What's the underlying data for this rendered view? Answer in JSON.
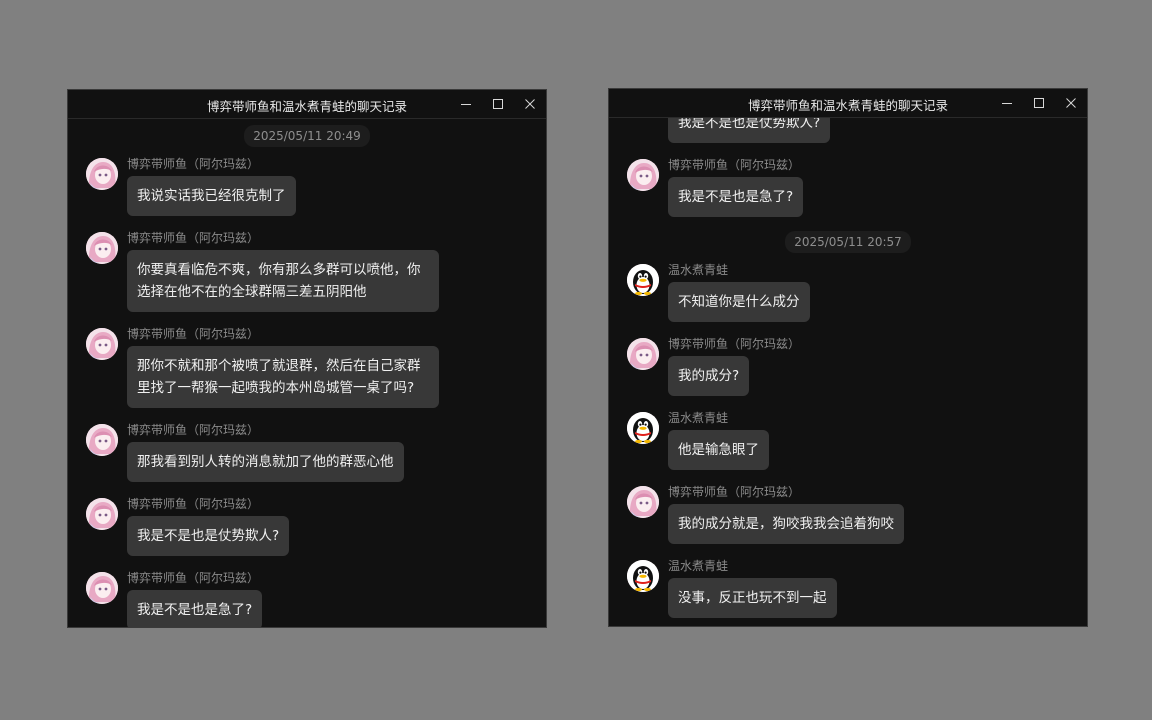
{
  "window_left": {
    "title": "博弈带师鱼和温水煮青蛙的聊天记录",
    "items": [
      {
        "kind": "timestamp",
        "text": "2025/05/11 20:49"
      },
      {
        "kind": "message",
        "sender": "博弈带师鱼（阿尔玛兹）",
        "avatar": "anime-girl-avatar",
        "text": "我说实话我已经很克制了"
      },
      {
        "kind": "message",
        "sender": "博弈带师鱼（阿尔玛兹）",
        "avatar": "anime-girl-avatar",
        "text": "你要真看临危不爽，你有那么多群可以喷他，你选择在他不在的全球群隔三差五阴阳他"
      },
      {
        "kind": "message",
        "sender": "博弈带师鱼（阿尔玛兹）",
        "avatar": "anime-girl-avatar",
        "text": "那你不就和那个被喷了就退群，然后在自己家群里找了一帮猴一起喷我的本州岛城管一桌了吗?"
      },
      {
        "kind": "message",
        "sender": "博弈带师鱼（阿尔玛兹）",
        "avatar": "anime-girl-avatar",
        "text": "那我看到别人转的消息就加了他的群恶心他"
      },
      {
        "kind": "message",
        "sender": "博弈带师鱼（阿尔玛兹）",
        "avatar": "anime-girl-avatar",
        "text": "我是不是也是仗势欺人?"
      },
      {
        "kind": "message",
        "sender": "博弈带师鱼（阿尔玛兹）",
        "avatar": "anime-girl-avatar",
        "text": "我是不是也是急了?"
      }
    ]
  },
  "window_right": {
    "title": "博弈带师鱼和温水煮青蛙的聊天记录",
    "items": [
      {
        "kind": "message",
        "sender": "博弈带师鱼（阿尔玛兹）",
        "avatar": "anime-girl-avatar",
        "text": "我是不是也是仗势欺人?"
      },
      {
        "kind": "message",
        "sender": "博弈带师鱼（阿尔玛兹）",
        "avatar": "anime-girl-avatar",
        "text": "我是不是也是急了?"
      },
      {
        "kind": "timestamp",
        "text": "2025/05/11 20:57"
      },
      {
        "kind": "message",
        "sender": "温水煮青蛙",
        "avatar": "qq-penguin-avatar",
        "text": "不知道你是什么成分"
      },
      {
        "kind": "message",
        "sender": "博弈带师鱼（阿尔玛兹）",
        "avatar": "anime-girl-avatar",
        "text": "我的成分?"
      },
      {
        "kind": "message",
        "sender": "温水煮青蛙",
        "avatar": "qq-penguin-avatar",
        "text": "他是输急眼了"
      },
      {
        "kind": "message",
        "sender": "博弈带师鱼（阿尔玛兹）",
        "avatar": "anime-girl-avatar",
        "text": "我的成分就是，狗咬我我会追着狗咬"
      },
      {
        "kind": "message",
        "sender": "温水煮青蛙",
        "avatar": "qq-penguin-avatar",
        "text": "没事，反正也玩不到一起"
      }
    ]
  },
  "window_controls": {
    "icons": [
      "minimize-icon",
      "maximize-icon",
      "close-icon"
    ]
  },
  "colors": {
    "page_bg": "#808080",
    "window_bg": "#111111",
    "bubble_bg": "#383838",
    "sender_text": "#8a8a8a",
    "bubble_text": "#f0f0f0"
  }
}
